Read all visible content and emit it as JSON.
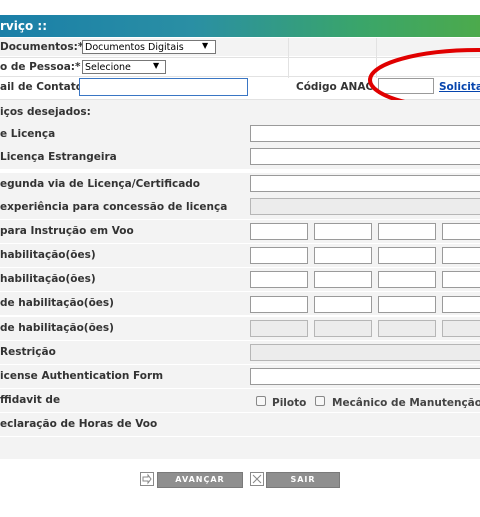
{
  "header": {
    "title": "rviço ::"
  },
  "doc_row": {
    "label": "Documentos:*",
    "select_value": "Documentos Digitais"
  },
  "pessoa_row": {
    "label": "o de Pessoa:*",
    "select_value": "Selecione"
  },
  "contato_row": {
    "label": "ail de Contato",
    "codigo_label": "Código ANAC",
    "link": "Solicita"
  },
  "servicos": {
    "label": "iços desejados:"
  },
  "items": [
    {
      "label": "e Licença"
    },
    {
      "label": "Licença Estrangeira"
    },
    {
      "label": "egunda via de Licença/Certificado"
    },
    {
      "label": "experiência para concessão de licença"
    },
    {
      "label": "para Instrução em Voo"
    },
    {
      "label": "habilitação(ões)"
    },
    {
      "label": "habilitação(ões)"
    },
    {
      "label": "de habilitação(ões)"
    },
    {
      "label": "de habilitação(ões)"
    },
    {
      "label": "Restrição"
    },
    {
      "label": "icense Authentication Form"
    },
    {
      "label": "ffidavit de"
    },
    {
      "label": "eclaração de Horas de Voo"
    }
  ],
  "affidavit": {
    "piloto": "Piloto",
    "mecanico": "Mecânico de Manutenção A"
  },
  "buttons": {
    "avancar": "AVANÇAR",
    "sair": "SAIR"
  },
  "colors": {
    "link": "#0645ad",
    "annotation": "#e00000",
    "header_start": "#1a7fa8",
    "header_end": "#4caa4c"
  }
}
